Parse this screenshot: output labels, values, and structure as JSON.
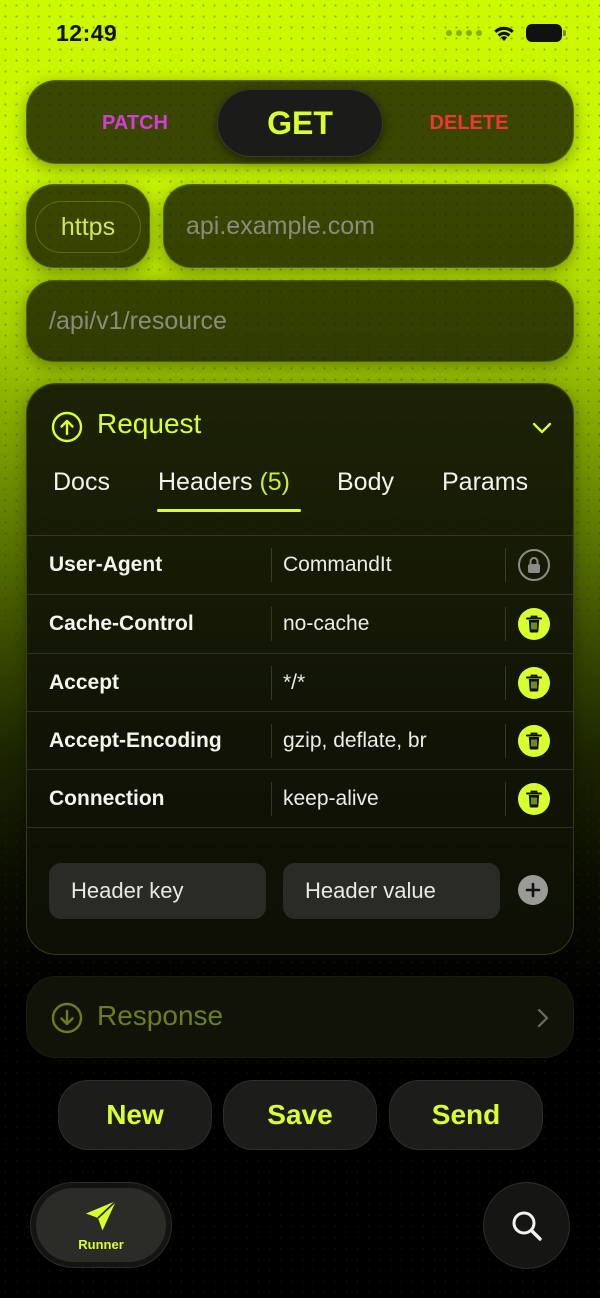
{
  "status_bar": {
    "time": "12:49"
  },
  "colors": {
    "accent": "#d8ff2e",
    "patch": "#d93ae0",
    "delete": "#f0343a",
    "background_top": "#cdfa00"
  },
  "methods": {
    "patch": "PATCH",
    "get": "GET",
    "delete": "DELETE",
    "selected": "GET"
  },
  "url": {
    "scheme": "https",
    "host_placeholder": "api.example.com",
    "path_placeholder": "/api/v1/resource"
  },
  "request": {
    "title": "Request",
    "tabs": {
      "docs": "Docs",
      "headers": "Headers",
      "headers_count": "(5)",
      "body": "Body",
      "params": "Params",
      "active": "Headers"
    },
    "headers": [
      {
        "key": "User-Agent",
        "value": "CommandIt",
        "action": "lock-icon"
      },
      {
        "key": "Cache-Control",
        "value": "no-cache",
        "action": "trash-icon"
      },
      {
        "key": "Accept",
        "value": "*/*",
        "action": "trash-icon"
      },
      {
        "key": "Accept-Encoding",
        "value": "gzip, deflate, br",
        "action": "trash-icon"
      },
      {
        "key": "Connection",
        "value": "keep-alive",
        "action": "trash-icon"
      }
    ],
    "new_header": {
      "key_placeholder": "Header key",
      "value_placeholder": "Header value"
    }
  },
  "response": {
    "title": "Response"
  },
  "actions": {
    "new": "New",
    "save": "Save",
    "send": "Send"
  },
  "tabbar": {
    "runner": "Runner"
  }
}
